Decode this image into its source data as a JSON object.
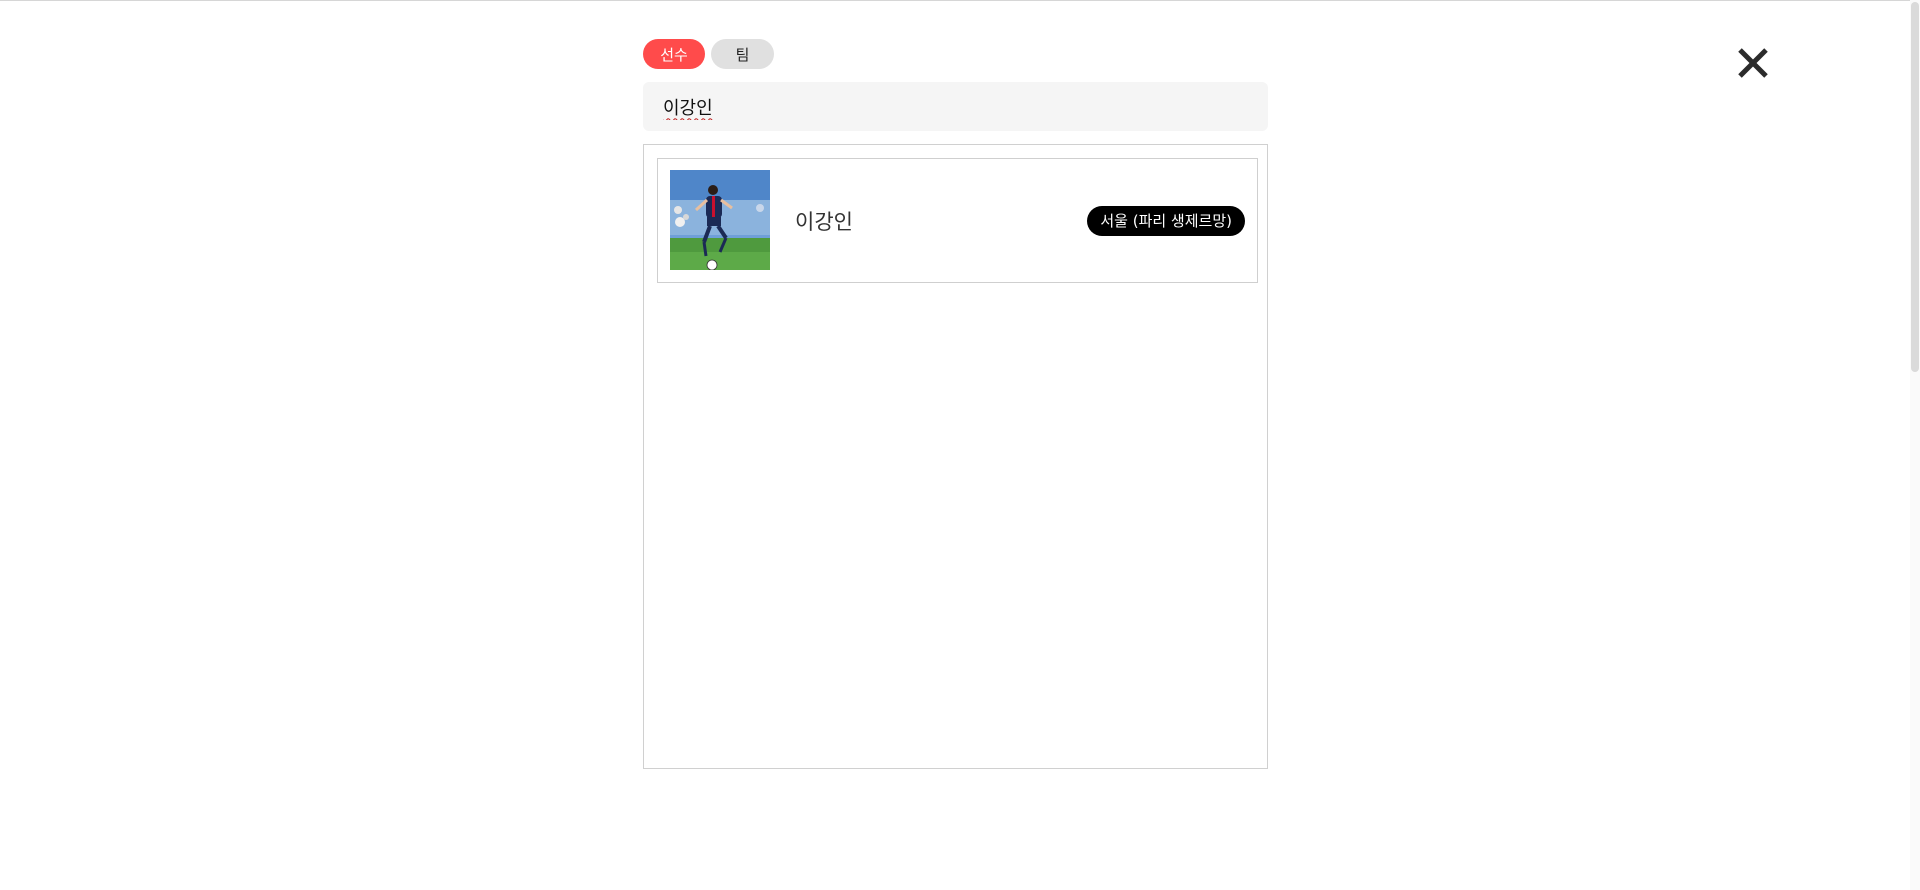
{
  "tabs": [
    {
      "label": "선수",
      "active": true
    },
    {
      "label": "팀",
      "active": false
    }
  ],
  "search": {
    "value": "이강인"
  },
  "results": [
    {
      "name": "이강인",
      "team": "서울 (파리 생제르망)",
      "photo_icon": "player-photo"
    }
  ],
  "close": {
    "icon": "close-icon"
  },
  "colors": {
    "active_tab": "#ff4b4b",
    "inactive_tab": "#e0e0e0",
    "badge": "#000000"
  }
}
